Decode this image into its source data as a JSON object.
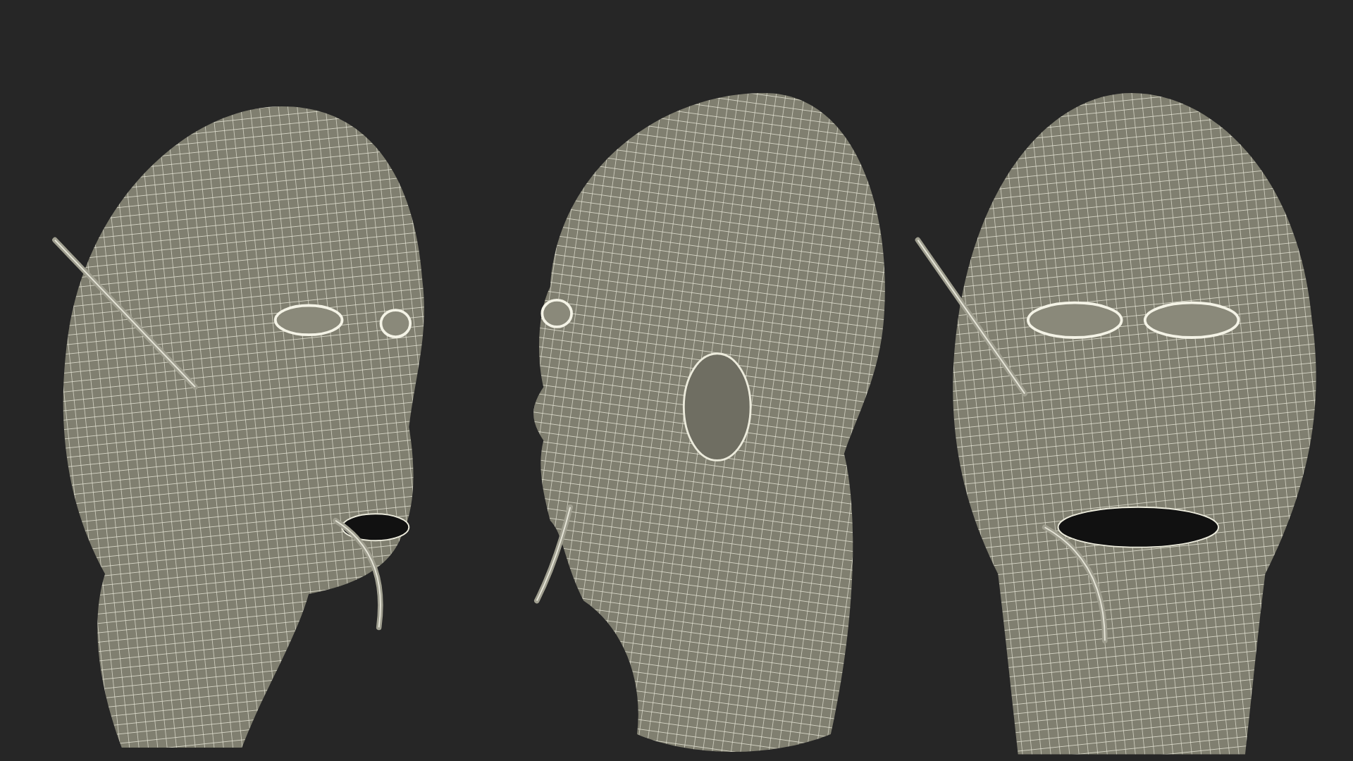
{
  "views": [
    {
      "kind": "three-quarter"
    },
    {
      "kind": "profile"
    },
    {
      "kind": "front"
    }
  ]
}
